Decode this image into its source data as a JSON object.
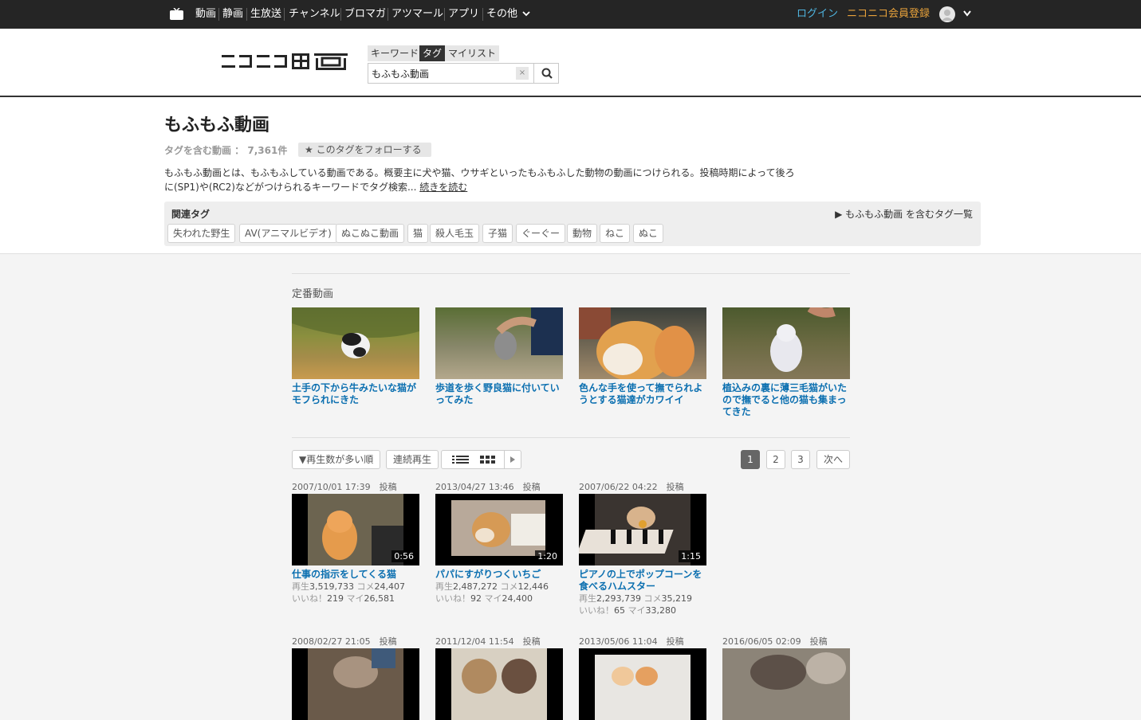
{
  "topnav": {
    "items": [
      "動画",
      "静画",
      "生放送",
      "チャンネル",
      "ブロマガ",
      "アツマール",
      "アプリ",
      "その他"
    ],
    "login": "ログイン",
    "signup": "ニコニコ会員登録"
  },
  "header": {
    "logo_text": "ニコニコ動画",
    "search_tabs": [
      "キーワード",
      "タグ",
      "マイリスト"
    ],
    "search_value": "もふもふ動画",
    "clear_label": "×"
  },
  "tag": {
    "title": "もふもふ動画",
    "count_label": "タグを含む動画 ： 7,361件",
    "follow": "★ このタグをフォローする",
    "description": "もふもふ動画とは、もふもふしている動画である。概要主に犬や猫、ウサギといったもふもふした動物の動画につけられる。投稿時期によって後ろに(SP1)や(RC2)などがつけられるキーワードでタグ検索...",
    "read_more": "続きを読む",
    "related_label": "関連タグ",
    "related_all": "▶ もふもふ動画 を含むタグ一覧",
    "related": [
      "失われた野生",
      "AV(アニマルビデオ)",
      "ぬこぬこ動画",
      "猫",
      "殺人毛玉",
      "子猫",
      "ぐーぐー",
      "動物",
      "ねこ",
      "ぬこ"
    ]
  },
  "featured": {
    "title": "定番動画",
    "videos": [
      {
        "title": "土手の下から牛みたいな猫がモフられにきた"
      },
      {
        "title": "歩道を歩く野良猫に付いていってみた"
      },
      {
        "title": "色んな手を使って撫でられようとする猫達がカワイイ"
      },
      {
        "title": "植込みの裏に薄三毛猫がいたので撫でると他の猫も集まってきた"
      }
    ]
  },
  "controls": {
    "sort": "▼再生数が多い順",
    "continuous": "連続再生",
    "pages": [
      "1",
      "2",
      "3"
    ],
    "next": "次へ"
  },
  "stat_labels": {
    "view": "再生",
    "comment": "コメ",
    "like": "いいね！",
    "mylist": "マイ"
  },
  "videos": [
    {
      "date": "2007/10/01 17:39　投稿",
      "duration": "0:56",
      "title": "仕事の指示をしてくる猫",
      "views": "3,519,733",
      "comments": "24,407",
      "likes": "219",
      "mylists": "26,581"
    },
    {
      "date": "2013/04/27 13:46　投稿",
      "duration": "1:20",
      "title": "パパにすがりつくいちご",
      "views": "2,487,272",
      "comments": "12,446",
      "likes": "92",
      "mylists": "24,400"
    },
    {
      "date": "2007/06/22 04:22　投稿",
      "duration": "1:15",
      "title": "ピアノの上でポップコーンを食べるハムスター",
      "views": "2,293,739",
      "comments": "35,219",
      "likes": "65",
      "mylists": "33,280"
    }
  ],
  "videos_row2": [
    {
      "date": "2008/02/27 21:05　投稿"
    },
    {
      "date": "2011/12/04 11:54　投稿"
    },
    {
      "date": "2013/05/06 11:04　投稿"
    },
    {
      "date": "2016/06/05 02:09　投稿"
    }
  ]
}
